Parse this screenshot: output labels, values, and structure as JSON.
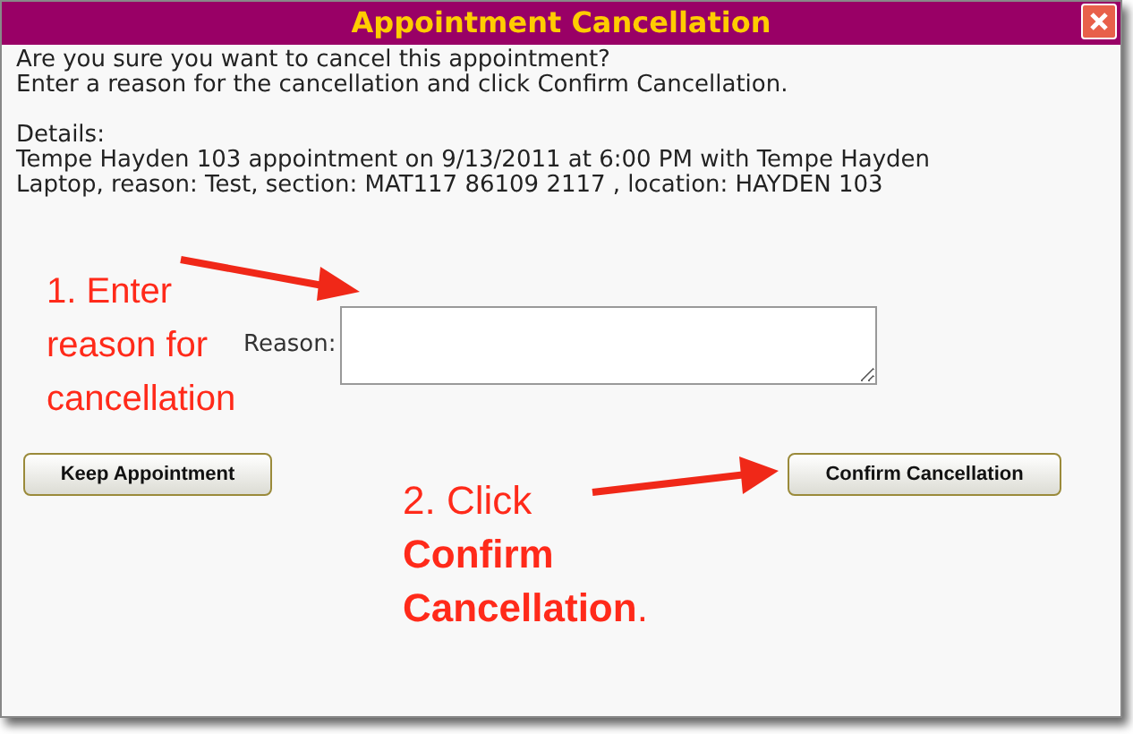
{
  "dialog": {
    "title": "Appointment Cancellation",
    "message": [
      "Are you sure you want to cancel this appointment?",
      "Enter a reason for the cancellation and click Confirm Cancellation."
    ],
    "details_label": "Details:",
    "details": "Tempe Hayden 103 appointment on 9/13/2011 at 6:00 PM with Tempe Hayden Laptop, reason: Test, section: MAT117 86109 2117 , location: HAYDEN 103",
    "reason_label": "Reason:",
    "buttons": [
      {
        "label": "Keep Appointment"
      },
      {
        "label": "Confirm Cancellation"
      }
    ]
  },
  "annotations": [
    {
      "text": "1. Enter reason for cancellation"
    },
    {
      "text": "2. Click\n**Confirm Cancellation**."
    }
  ]
}
